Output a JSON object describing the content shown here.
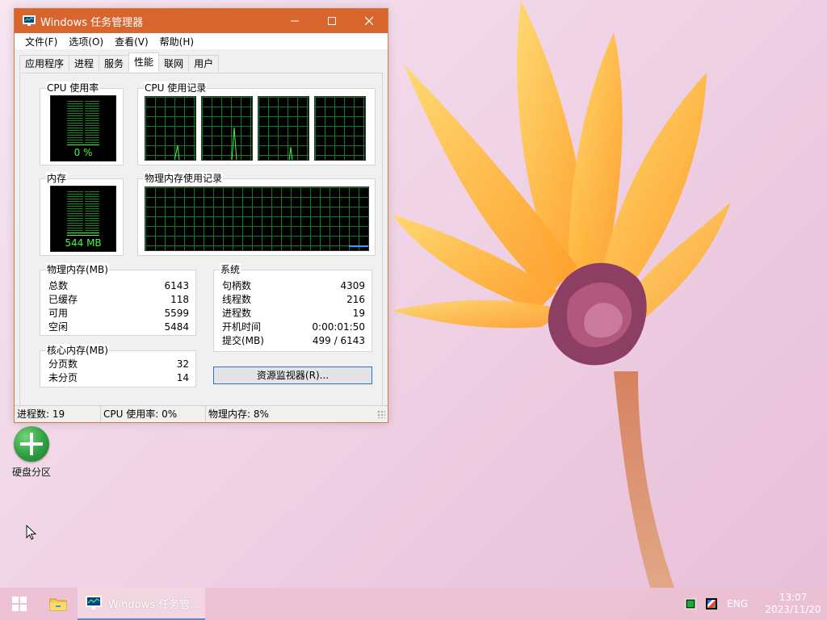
{
  "window": {
    "title": "Windows 任务管理器",
    "menus": [
      "文件(F)",
      "选项(O)",
      "查看(V)",
      "帮助(H)"
    ],
    "tabs": [
      {
        "label": "应用程序"
      },
      {
        "label": "进程"
      },
      {
        "label": "服务"
      },
      {
        "label": "性能"
      },
      {
        "label": "联网"
      },
      {
        "label": "用户"
      }
    ],
    "active_tab": "性能"
  },
  "performance": {
    "cpu_usage": {
      "label": "CPU 使用率",
      "value_text": "0 %",
      "value_percent": 0
    },
    "cpu_history": {
      "label": "CPU 使用记录"
    },
    "memory": {
      "label": "内存",
      "value_text": "544 MB"
    },
    "memory_history": {
      "label": "物理内存使用记录"
    },
    "physical_memory": {
      "title": "物理内存(MB)",
      "rows": [
        {
          "label": "总数",
          "value": "6143"
        },
        {
          "label": "已缓存",
          "value": "118"
        },
        {
          "label": "可用",
          "value": "5599"
        },
        {
          "label": "空闲",
          "value": "5484"
        }
      ]
    },
    "kernel_memory": {
      "title": "核心内存(MB)",
      "rows": [
        {
          "label": "分页数",
          "value": "32"
        },
        {
          "label": "未分页",
          "value": "14"
        }
      ]
    },
    "system": {
      "title": "系统",
      "rows": [
        {
          "label": "句柄数",
          "value": "4309"
        },
        {
          "label": "线程数",
          "value": "216"
        },
        {
          "label": "进程数",
          "value": "19"
        },
        {
          "label": "开机时间",
          "value": "0:00:01:50"
        },
        {
          "label": "提交(MB)",
          "value": "499 / 6143"
        }
      ]
    },
    "resource_monitor_button": "资源监视器(R)..."
  },
  "statusbar": {
    "processes": "进程数: 19",
    "cpu": "CPU 使用率: 0%",
    "memory": "物理内存: 8%"
  },
  "desktop": {
    "icon_label": "硬盘分区"
  },
  "taskbar": {
    "task_label": "Windows 任务管...",
    "language": "ENG",
    "time": "13:07",
    "date": "2023/11/20"
  },
  "colors": {
    "titlebar": "#d8652d",
    "meter_green": "#36ff37",
    "grid_green": "#0a7f2b",
    "accent_blue": "#2b6fd0"
  },
  "icons": [
    "task-manager-icon",
    "minimize-icon",
    "maximize-icon",
    "close-icon",
    "windows-logo-icon",
    "folder-icon",
    "network-icon",
    "color-icon"
  ]
}
